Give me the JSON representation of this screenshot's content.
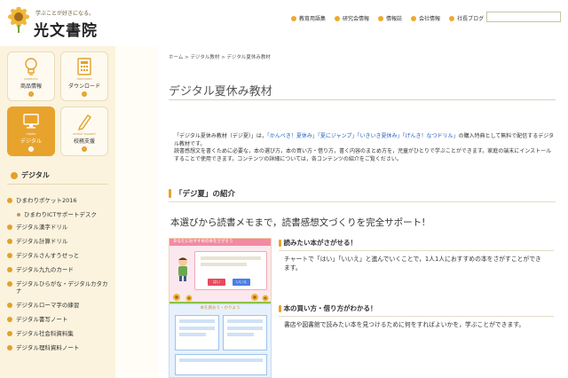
{
  "header": {
    "logo_tagline": "学ぶことが好きになる。",
    "logo_name": "光文書院",
    "nav": [
      "教育用語集",
      "研究会情報",
      "情報誌",
      "会社情報",
      "社長ブログ"
    ],
    "search_placeholder": ""
  },
  "sidebar": {
    "categories": [
      {
        "sub": "products",
        "label": "商品情報",
        "icon": "lightbulb-icon"
      },
      {
        "sub": "download",
        "label": "ダウンロード",
        "icon": "calculator-icon"
      },
      {
        "sub": "digital",
        "label": "デジタル",
        "icon": "computer-icon"
      },
      {
        "sub": "school support",
        "label": "校務支援",
        "icon": "pencil-icon"
      }
    ],
    "arrow": "›",
    "heading": "デジタル",
    "items": [
      "ひまわりポケット2016",
      "ひまわりICTサポートデスク",
      "デジタル漢字ドリル",
      "デジタル計算ドリル",
      "デジタルさんすうせっと",
      "デジタル九九のカード",
      "デジタルひらがな・デジタルカタカナ",
      "デジタルローマ字の練習",
      "デジタル書写ノート",
      "デジタル社会科資料集",
      "デジタル理科資料ノート"
    ]
  },
  "main": {
    "breadcrumb": "ホーム > デジタル教材 > デジタル夏休み教材",
    "title": "デジタル夏休み教材",
    "intro": {
      "t1": "「デジタル夏休み教材（デジ夏）」は，",
      "link1": "「かんぺき！夏休み」",
      "link2": "「夏にジャンプ」",
      "link3": "「いきいき夏休み」",
      "link4": "「げんき！なつドリル」",
      "t2": "の購入特典として無料で配信するデジタル教材です。",
      "t3": "読書感想文を書くために必要な，本の選び方，本の買い方・借り方，書く内容のまとめ方を，児童がひとりで学ぶことができます。家庭の端末にインストールすることで使用できます。コンテンツの詳細については，各コンテンツの紹介をご覧ください。"
    },
    "section_title": "「デジ夏」の紹介",
    "hero": "本選びから読書メモまで，読書感想文づくりを完全サポート!",
    "thumb1": {
      "title": "あなたにおすすめの本をさがそう",
      "buttons": [
        "はい",
        "いいえ"
      ]
    },
    "thumb2": {
      "title": "本を買おう・かりよう"
    },
    "features": [
      {
        "title": "読みたい本がさがせる！",
        "body": "チャートで「はい」「いいえ」と進んでいくことで，1人1人におすすめの本をさがすことができます。"
      },
      {
        "title": "本の買い方・借り方がわかる！",
        "body": "書店や図書館で読みたい本を見つけるために何をすればよいかを，学ぶことができます。"
      }
    ]
  },
  "colors": {
    "accent": "#e8a32d",
    "link": "#1d5fc0",
    "sidebar_bg": "#fbf3de"
  }
}
